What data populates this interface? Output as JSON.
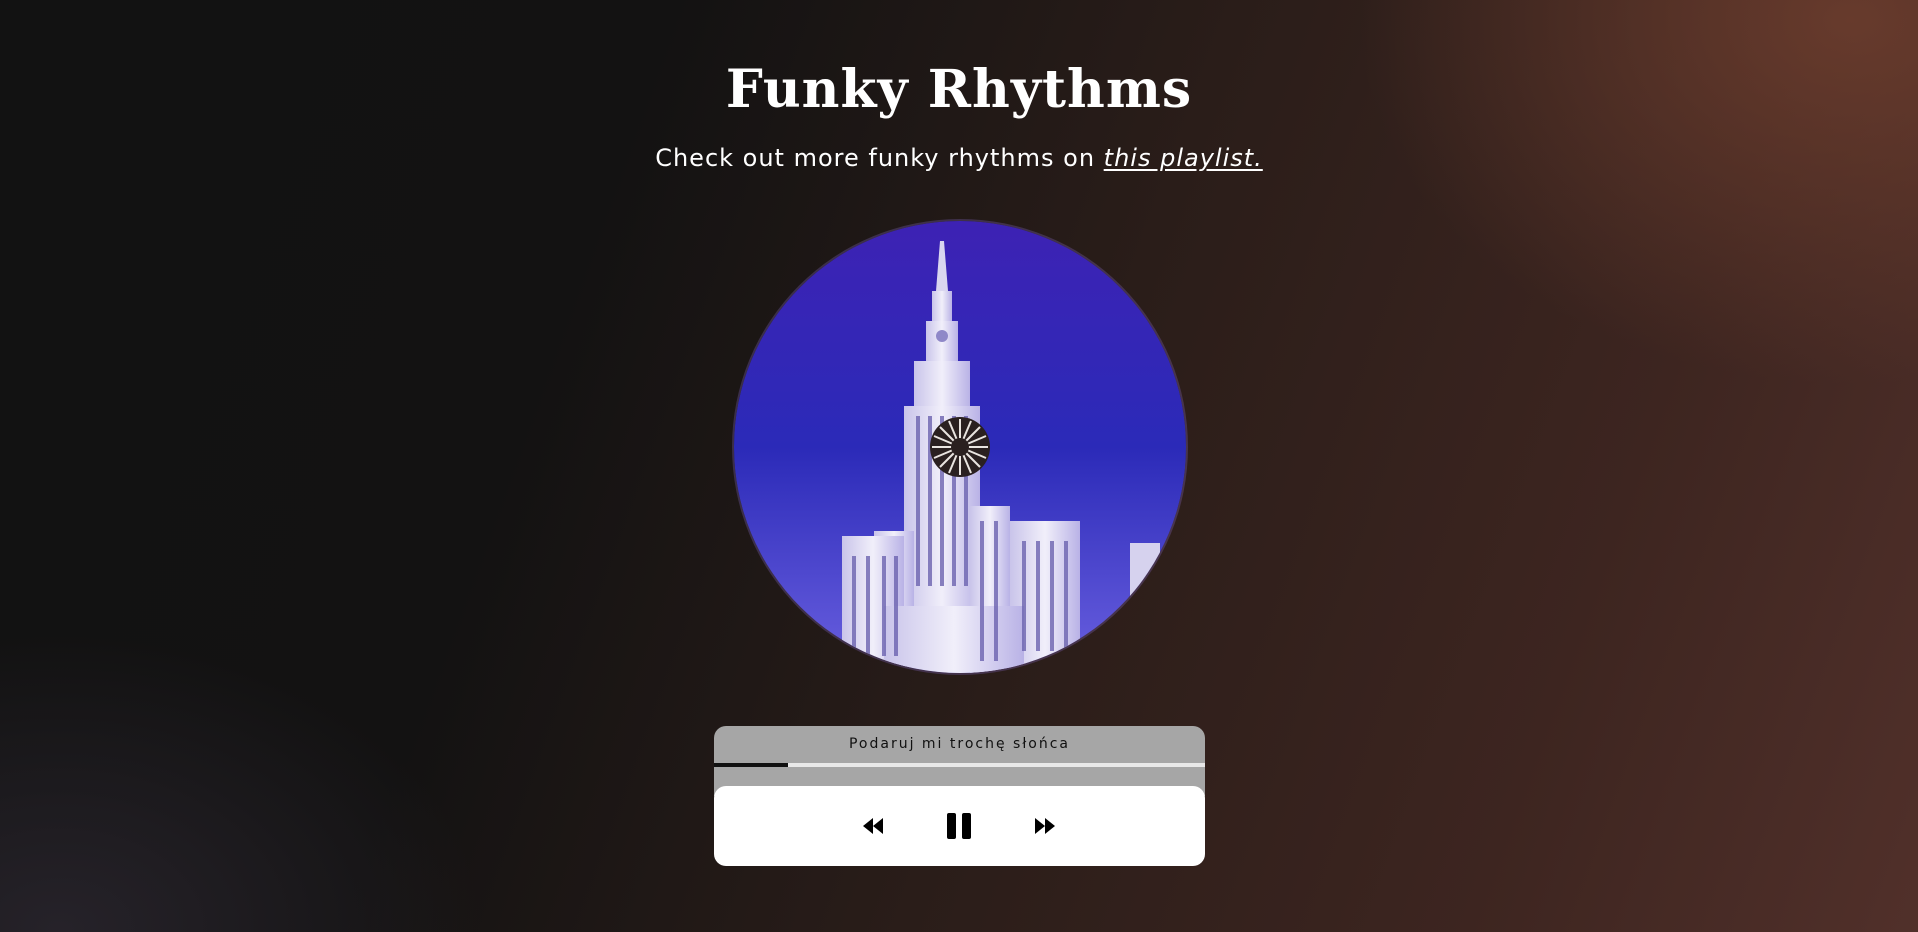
{
  "header": {
    "title": "Funky Rhythms",
    "subtitle_prefix": "Check out more funky rhythms on",
    "playlist_link": "this playlist."
  },
  "player": {
    "track_title": "Podaruj mi trochę słońca",
    "progress": 0.15,
    "state": "playing",
    "controls": {
      "prev_icon": "rewind-icon",
      "pause_icon": "pause-icon",
      "next_icon": "fast-forward-icon"
    }
  },
  "cover": {
    "description_icon": "album-cover",
    "colors": {
      "sky_top": "#3b24b6",
      "sky_bottom": "#5548d6",
      "building": "#e6e4f2"
    }
  }
}
